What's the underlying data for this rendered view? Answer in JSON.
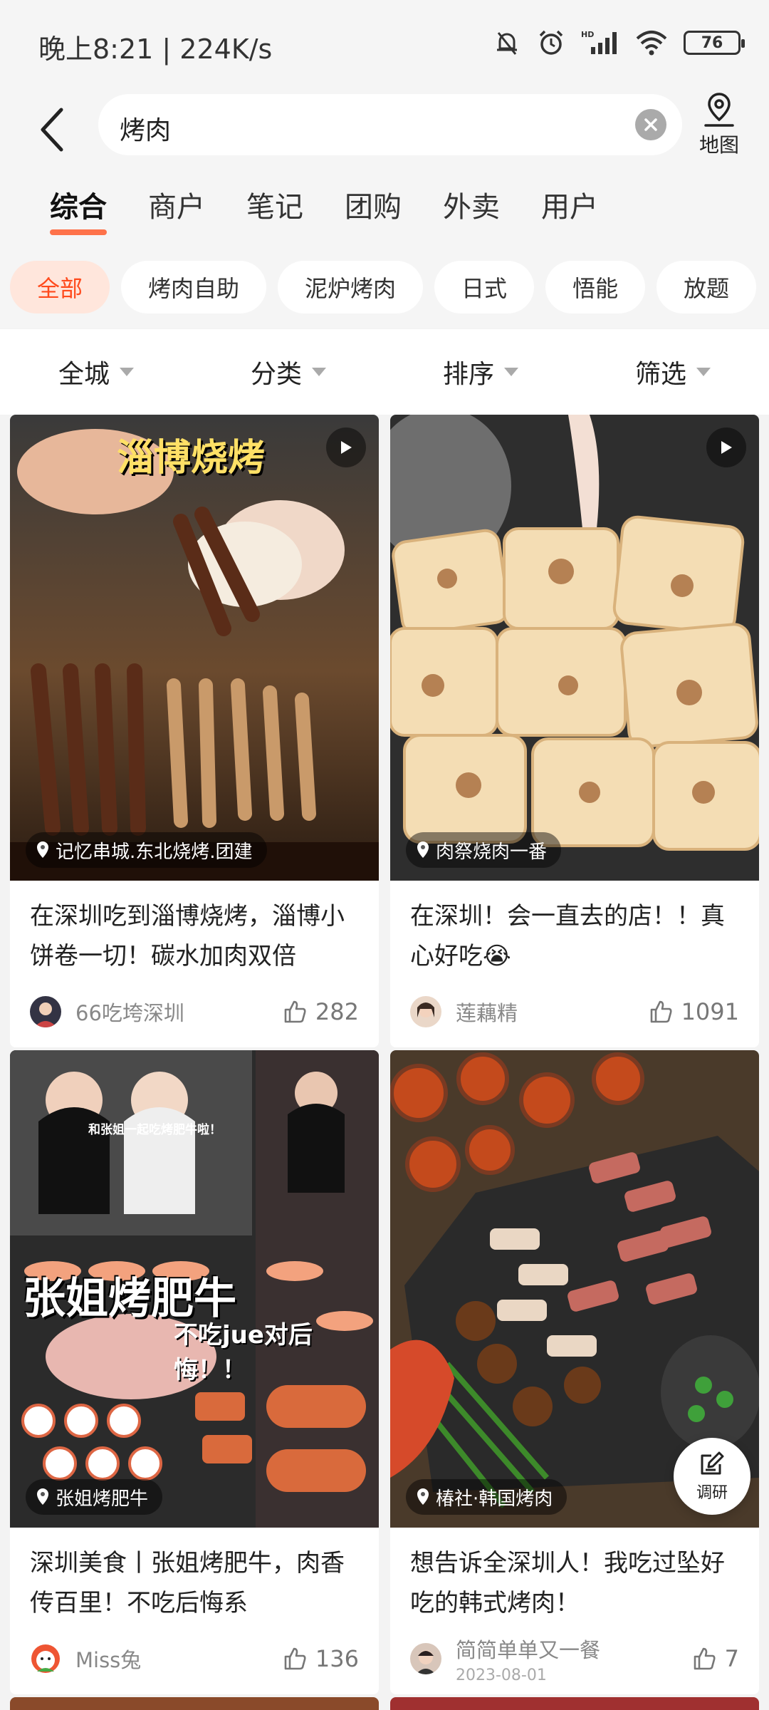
{
  "status_bar": {
    "time_speed": "晚上8:21 | 224K/s",
    "battery": "76"
  },
  "search": {
    "value": "烤肉",
    "map_label": "地图"
  },
  "tabs": [
    {
      "label": "综合",
      "active": true
    },
    {
      "label": "商户"
    },
    {
      "label": "笔记"
    },
    {
      "label": "团购"
    },
    {
      "label": "外卖"
    },
    {
      "label": "用户"
    }
  ],
  "chips": [
    {
      "label": "全部",
      "active": true
    },
    {
      "label": "烤肉自助"
    },
    {
      "label": "泥炉烤肉"
    },
    {
      "label": "日式"
    },
    {
      "label": "悟能"
    },
    {
      "label": "放题"
    }
  ],
  "filters": [
    "全城",
    "分类",
    "排序",
    "筛选"
  ],
  "cards": [
    {
      "image_text": "淄博烧烤",
      "location": "记忆串城.东北烧烤.团建",
      "title": "在深圳吃到淄博烧烤，淄博小饼卷一切！碳水加肉双倍",
      "author": "66吃垮深圳",
      "likes": "282",
      "has_video": true
    },
    {
      "location": "肉祭烧肉一番",
      "title": "在深圳！会一直去的店！！真心好吃😭",
      "author": "莲藕精",
      "likes": "1091",
      "has_video": true
    },
    {
      "image_text": "张姐烤肥牛",
      "image_subtext": "不吃jue对后悔！！",
      "image_caption": "和张姐一起吃烤肥牛啦！",
      "location": "张姐烤肥牛",
      "title": "深圳美食丨张姐烤肥牛，肉香传百里！不吃后悔系",
      "author": "Miss兔",
      "likes": "136"
    },
    {
      "location": "椿社·韩国烤肉",
      "title": "想告诉全深圳人！我吃过坠好吃的韩式烤肉！",
      "author": "简简单单又一餐",
      "date": "2023-08-01",
      "likes": "7"
    }
  ],
  "float_button": {
    "label": "调研"
  },
  "colors": {
    "accent": "#ff4a1c",
    "chip_active_bg": "#ffe6dc"
  }
}
